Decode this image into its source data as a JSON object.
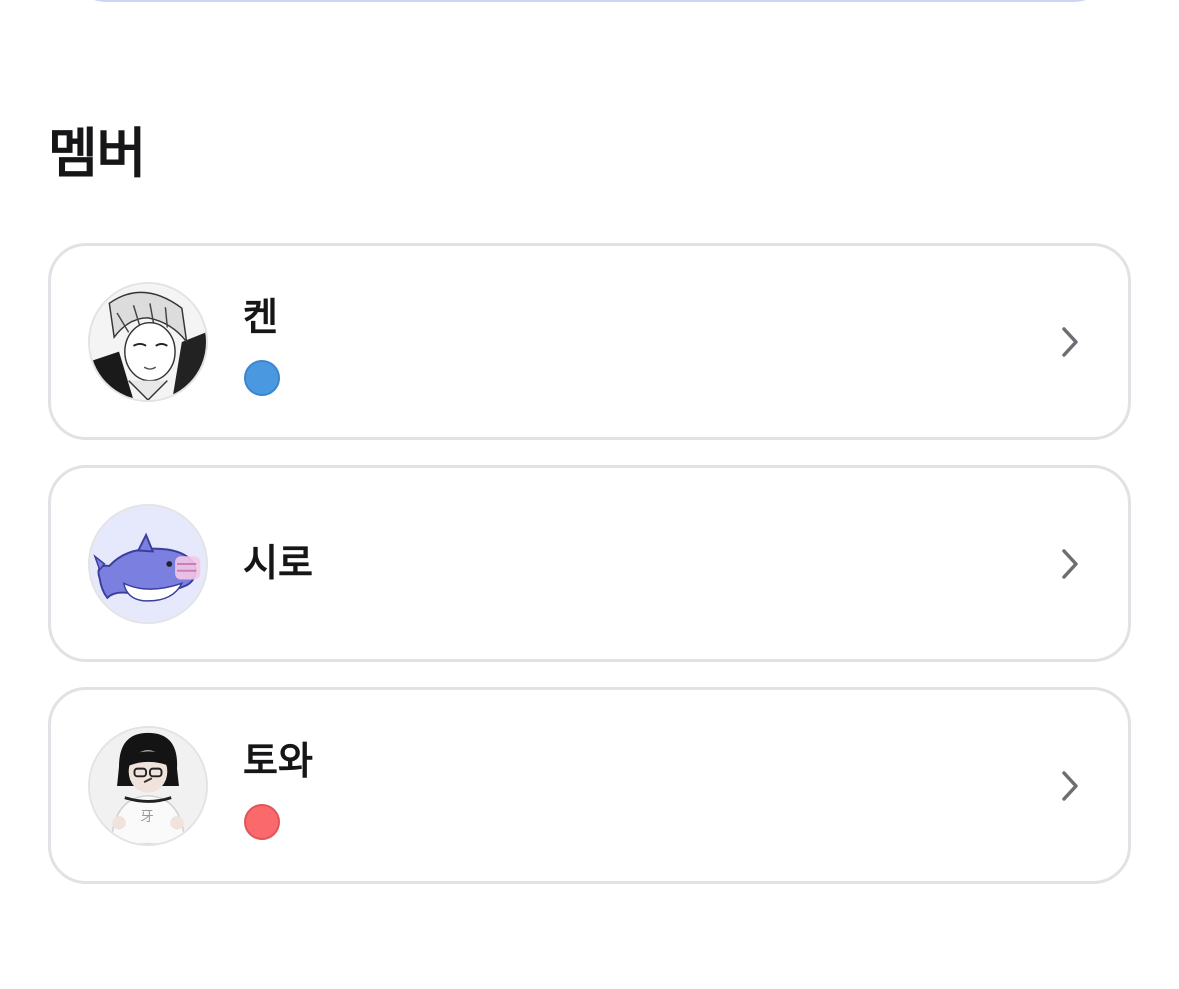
{
  "section": {
    "title": "멤버"
  },
  "members": [
    {
      "name": "켄",
      "dot_color": "#4a98e0",
      "avatar": "manga-portrait-avatar-icon"
    },
    {
      "name": "시로",
      "dot_color": null,
      "avatar": "purple-shark-avatar-icon"
    },
    {
      "name": "토와",
      "dot_color": "#fa6a6c",
      "avatar": "person-photo-avatar-icon"
    }
  ],
  "icons": {
    "chevron": "chevron-right-icon"
  },
  "colors": {
    "card_border": "#e2e2e6",
    "top_card_border": "#cfd3f3",
    "chevron": "#6d6d73",
    "text": "#161618"
  }
}
